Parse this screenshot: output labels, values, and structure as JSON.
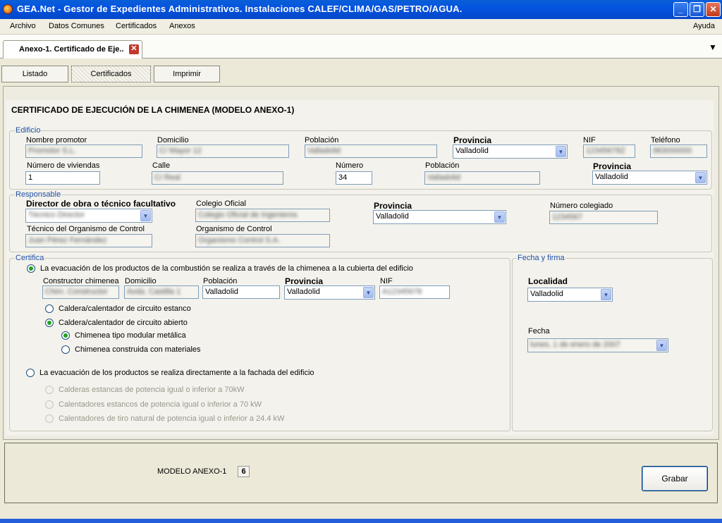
{
  "window": {
    "title": "GEA.Net - Gestor de Expedientes Administrativos. Instalaciones CALEF/CLIMA/GAS/PETRO/AGUA.",
    "btn_minimize": "_",
    "btn_maximize": "❐",
    "btn_close": "✕"
  },
  "menu": {
    "archivo": "Archivo",
    "datos_comunes": "Datos Comunes",
    "certificados": "Certificados",
    "anexos": "Anexos",
    "ayuda": "Ayuda"
  },
  "doc_tab": {
    "label": "Anexo-1. Certificado de Eje..",
    "close": "✕",
    "menu_arrow": "▼"
  },
  "buttons": {
    "listado": "Listado",
    "certificados": "Certificados",
    "imprimir": "Imprimir"
  },
  "heading": "CERTIFICADO DE EJECUCIÓN DE LA CHIMENEA (MODELO ANEXO-1)",
  "edificio": {
    "legend": "Edificio",
    "nombre_promotor_label": "Nombre promotor",
    "nombre_promotor": "Promotor S.L.",
    "domicilio_label": "Domicilio",
    "domicilio": "C/ Mayor 12",
    "poblacion_label": "Población",
    "poblacion": "Valladolid",
    "provincia_label": "Provincia",
    "provincia": "Valladolid",
    "nif_label": "NIF",
    "nif": "12345678Z",
    "telefono_label": "Teléfono",
    "telefono": "983000000",
    "num_viviendas_label": "Número de viviendas",
    "num_viviendas": "1",
    "calle_label": "Calle",
    "calle": "C/ Real",
    "numero_label": "Número",
    "numero": "34",
    "poblacion2_label": "Población",
    "poblacion2": "Valladolid",
    "provincia2_label": "Provincia",
    "provincia2": "Valladolid"
  },
  "responsable": {
    "legend": "Responsable",
    "director_label": "Director de obra o técnico facultativo",
    "director": "Técnico Director",
    "colegio_label": "Colegio Oficial",
    "colegio": "Colegio Oficial de Ingenieros",
    "provincia_label": "Provincia",
    "provincia": "Valladolid",
    "num_colegiado_label": "Número colegiado",
    "num_colegiado": "1234567",
    "tecnico_label": "Técnico del Organismo de Control",
    "tecnico": "Juan Pérez Fernández",
    "organismo_label": "Organismo de Control",
    "organismo": "Organismo Control S.A."
  },
  "certifica": {
    "legend": "Certifica",
    "opt1": "La evacuación de los productos de la combustión se realiza a través de la chimenea a la cubierta del edificio",
    "constructor_label": "Constructor chimenea",
    "constructor": "Chim. Constructor",
    "domicilio_label": "Domicilio",
    "domicilio": "Avda. Castilla 1",
    "poblacion_label": "Población",
    "poblacion": "Valladolid",
    "provincia_label": "Provincia",
    "provincia": "Valladolid",
    "nif_label": "NIF",
    "nif": "A12345678",
    "caldera_estanco": "Caldera/calentador de circuito estanco",
    "caldera_abierto": "Caldera/calentador de circuito abierto",
    "chimenea_modular": "Chimenea tipo modular metálica",
    "chimenea_construida": "Chimenea construida con materiales",
    "opt2": "La evacuación de los productos se realiza directamente a la fachada del edificio",
    "sub1": "Calderas estancas de potencia igual o inferior a 70kW",
    "sub2": "Calentadores estancos de potencia igual o inferior a 70 kW",
    "sub3": "Calentadores de tiro natural de potencia igual o inferior a 24.4 kW"
  },
  "fecha_firma": {
    "legend": "Fecha y firma",
    "localidad_label": "Localidad",
    "localidad": "Valladolid",
    "fecha_label": "Fecha",
    "fecha": "lunes, 1 de enero de 2007"
  },
  "footer": {
    "modelo_label": "MODELO ANEXO-1",
    "modelo_value": "6",
    "grabar": "Grabar"
  }
}
